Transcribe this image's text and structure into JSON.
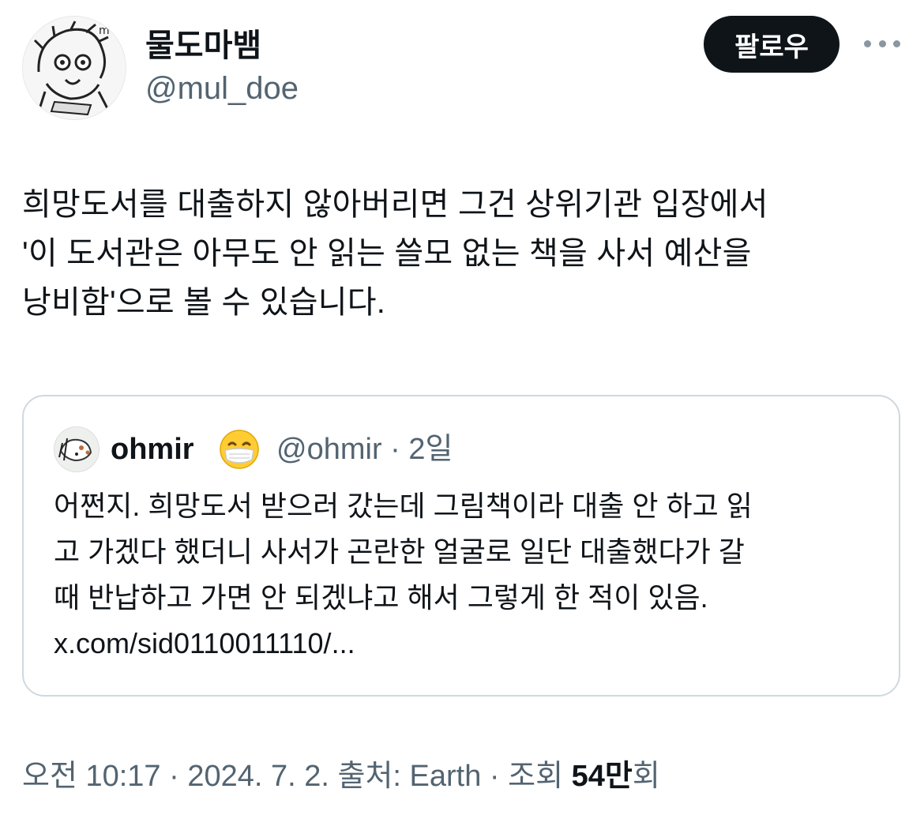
{
  "author": {
    "display_name": "물도마뱀",
    "handle": "@mul_doe",
    "avatar_icon": "cartoon-avatar-icon"
  },
  "follow_label": "팔로우",
  "more_icon": "more-dots-icon",
  "tweet": {
    "lines": [
      "희망도서를 대출하지 않아버리면 그건 상위기관 입장에서",
      "'이 도서관은 아무도 안 읽는 쓸모 없는 책을 사서 예산을",
      "낭비함'으로 볼 수 있습니다."
    ]
  },
  "quote": {
    "name": "ohmir",
    "emoji_icon": "face-with-mask-emoji-icon",
    "handle_time": "@ohmir · 2일",
    "lines": [
      "어쩐지. 희망도서 받으러 갔는데 그림책이라 대출 안 하고 읽",
      "고 가겠다 했더니 사서가 곤란한 얼굴로 일단 대출했다가 갈",
      "때 반납하고 가면 안 되겠냐고 해서 그렇게 한 적이 있음.",
      "x.com/sid0110011110/..."
    ]
  },
  "meta": {
    "time_date_source": "오전 10:17 · 2024. 7. 2. 출처: Earth · 조회 ",
    "views_count": "54만",
    "views_suffix": "회"
  },
  "colors": {
    "text": "#0f1419",
    "secondary": "#536471",
    "border": "#cfd9de",
    "follow_bg": "#0f1419"
  }
}
